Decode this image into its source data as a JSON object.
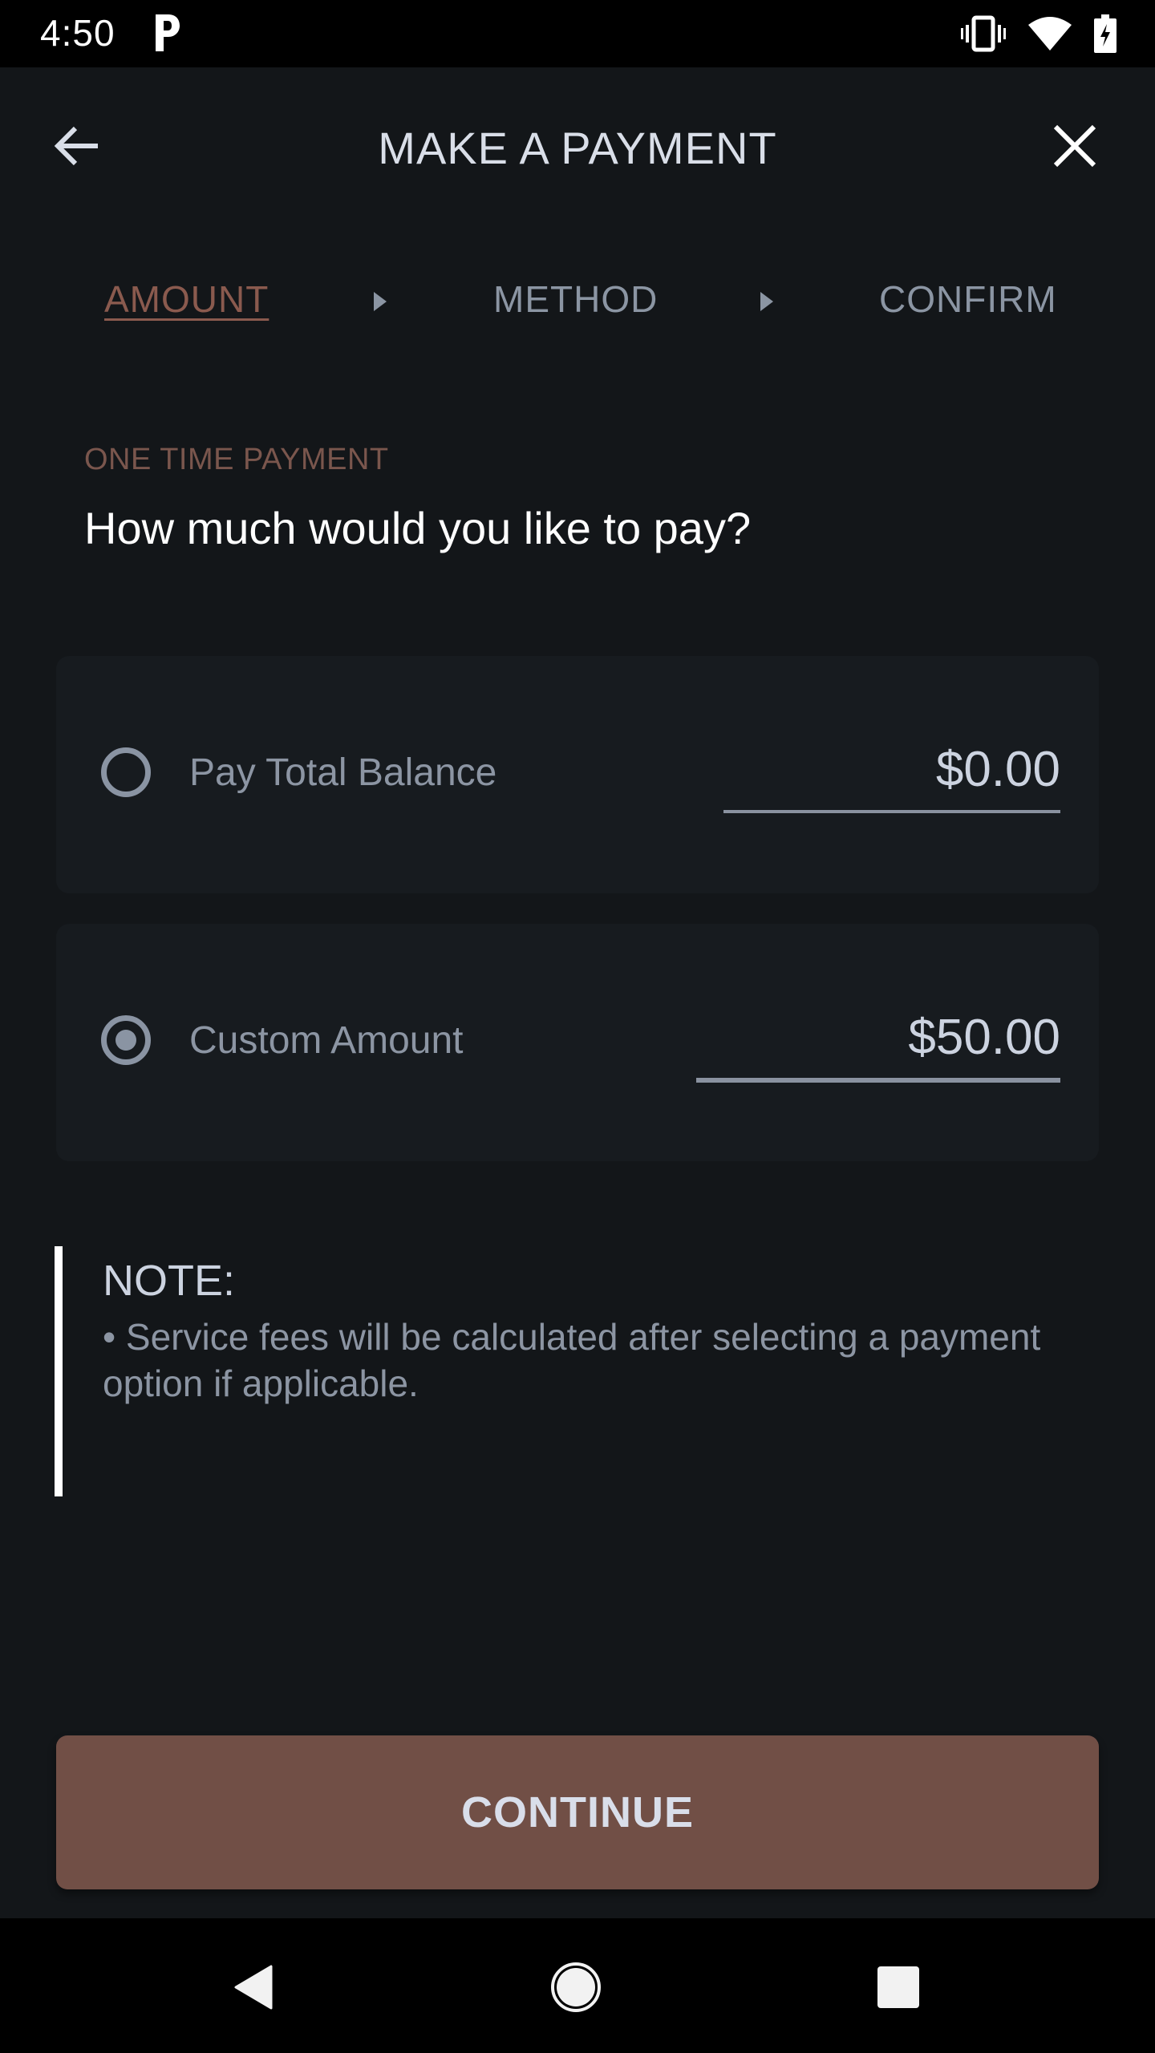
{
  "status_bar": {
    "time": "4:50",
    "icons": [
      "parking-p-icon",
      "vibrate-icon",
      "wifi-icon",
      "battery-charging-icon"
    ]
  },
  "header": {
    "title": "MAKE A PAYMENT",
    "back_icon": "arrow-left-icon",
    "close_icon": "close-x-icon"
  },
  "steps": [
    {
      "label": "AMOUNT",
      "active": true
    },
    {
      "label": "METHOD",
      "active": false
    },
    {
      "label": "CONFIRM",
      "active": false
    }
  ],
  "section": {
    "eyebrow": "ONE TIME PAYMENT",
    "question": "How much would you like to pay?"
  },
  "options": [
    {
      "label": "Pay Total Balance",
      "amount": "$0.00",
      "selected": false
    },
    {
      "label": "Custom Amount",
      "amount": "$50.00",
      "selected": true
    }
  ],
  "note": {
    "title": "NOTE:",
    "body": "• Service fees will be calculated after selecting a payment option if applicable."
  },
  "actions": {
    "continue_label": "CONTINUE"
  },
  "colors": {
    "accent": "#714f46",
    "accent_text": "#8a5a4e",
    "background": "#131619",
    "card": "#171b1f",
    "muted_text": "#8c95a3"
  },
  "nav_bar": {
    "icons": [
      "nav-back-icon",
      "nav-home-icon",
      "nav-recents-icon"
    ]
  }
}
